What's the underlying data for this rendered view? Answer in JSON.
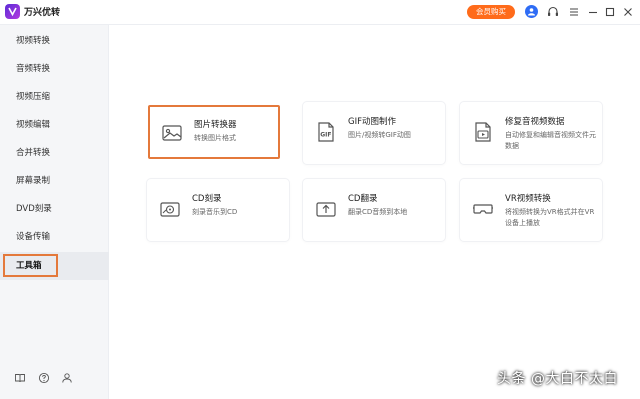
{
  "app": {
    "title": "万兴优转"
  },
  "titlebar": {
    "vip_label": "会员购买"
  },
  "sidebar": {
    "items": [
      {
        "label": "视频转换"
      },
      {
        "label": "音频转换"
      },
      {
        "label": "视频压缩"
      },
      {
        "label": "视频编辑"
      },
      {
        "label": "合并转换"
      },
      {
        "label": "屏幕录制"
      },
      {
        "label": "DVD刻录"
      },
      {
        "label": "设备传输"
      },
      {
        "label": "工具箱",
        "active": true
      }
    ]
  },
  "tools": [
    {
      "title": "图片转换器",
      "desc": "转换图片格式",
      "icon": "image-icon",
      "highlighted": true
    },
    {
      "title": "GIF动图制作",
      "desc": "图片/视频转GIF动图",
      "icon": "gif-icon"
    },
    {
      "title": "修复音视频数据",
      "desc": "自动修复和编辑音视频文件元数据",
      "icon": "video-metadata-icon"
    },
    {
      "title": "CD刻录",
      "desc": "刻录音乐到CD",
      "icon": "cd-burn-icon"
    },
    {
      "title": "CD翻录",
      "desc": "翻录CD音频到本地",
      "icon": "cd-rip-icon"
    },
    {
      "title": "VR视频转换",
      "desc": "将视频转换为VR格式并在VR设备上播放",
      "icon": "vr-headset-icon"
    }
  ],
  "watermark": "头条 @大白不太白",
  "colors": {
    "accent": "#ff6b1a",
    "highlight_border": "#e4793b",
    "avatar": "#2e6cf5"
  }
}
